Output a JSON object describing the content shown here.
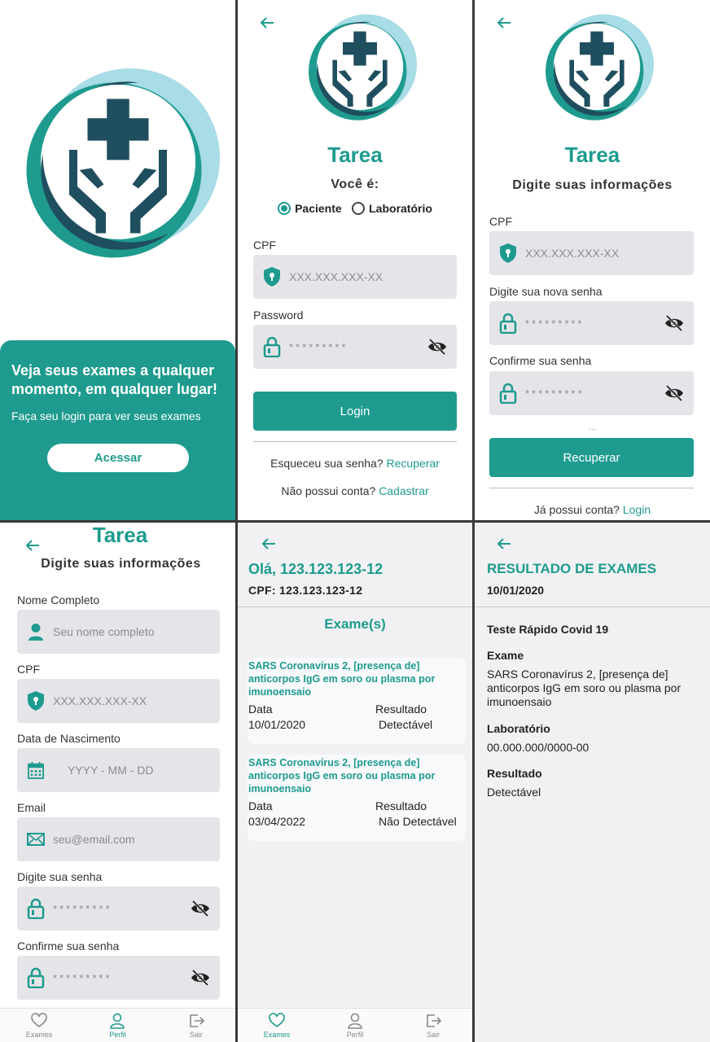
{
  "app": {
    "name": "Tarea"
  },
  "colors": {
    "accent": "#1e9b8e",
    "light_accent": "#a8dce6",
    "dark": "#1f4e5f",
    "field_bg": "#e5e5e9"
  },
  "splash": {
    "headline": "Veja seus exames a qualquer momento, em qualquer lugar!",
    "sub": "Faça seu login para ver seus exames",
    "button": "Acessar"
  },
  "login": {
    "prompt": "Você é:",
    "options": [
      "Paciente",
      "Laboratório"
    ],
    "selected": "Paciente",
    "cpf_label": "CPF",
    "cpf_placeholder": "XXX.XXX.XXX-XX",
    "password_label": "Password",
    "password_placeholder": "*********",
    "button": "Login",
    "forgot_text": "Esqueceu sua senha?",
    "forgot_link": "Recuperar",
    "register_text": "Não possui conta?",
    "register_link": "Cadastrar"
  },
  "recover": {
    "subtitle": "Digite suas informações",
    "cpf_label": "CPF",
    "cpf_placeholder": "XXX.XXX.XXX-XX",
    "new_pass_label": "Digite sua nova senha",
    "confirm_label": "Confirme sua senha",
    "pass_placeholder": "*********",
    "ellipsis": "...",
    "button": "Recuperar",
    "login_text": "Já possui conta?",
    "login_link": "Login"
  },
  "register": {
    "subtitle": "Digite suas informações",
    "name_label": "Nome Completo",
    "name_placeholder": "Seu nome completo",
    "cpf_label": "CPF",
    "cpf_placeholder": "XXX.XXX.XXX-XX",
    "birth_label": "Data de Nascimento",
    "birth_placeholder": "YYYY - MM - DD",
    "email_label": "Email",
    "email_placeholder": "seu@email.com",
    "pass_label": "Digite sua senha",
    "confirm_label": "Confirme sua senha",
    "pass_placeholder": "*********"
  },
  "tabs": [
    "Exames",
    "Perfil",
    "Sair"
  ],
  "exams": {
    "greeting": "Olá, 123.123.123-12",
    "cpf_line": "CPF: 123.123.123-12",
    "section": "Exame(s)",
    "date_header": "Data",
    "result_header": "Resultado",
    "items": [
      {
        "title": "SARS Coronavírus 2, [presença de] anticorpos IgG em soro ou plasma por imunoensaio",
        "date": "10/01/2020",
        "result": "Detectável"
      },
      {
        "title": "SARS Coronavírus 2, [presença de] anticorpos IgG em soro ou plasma por imunoensaio",
        "date": "03/04/2022",
        "result": "Não Detectável"
      }
    ]
  },
  "result": {
    "title": "RESULTADO DE EXAMES",
    "date": "10/01/2020",
    "test_name": "Teste Rápido Covid 19",
    "exam_label": "Exame",
    "exam_value": "SARS Coronavírus 2, [presença de] anticorpos IgG em soro ou plasma por imunoensaio",
    "lab_label": "Laboratório",
    "lab_value": "00.000.000/0000-00",
    "result_label": "Resultado",
    "result_value": "Detectável"
  }
}
